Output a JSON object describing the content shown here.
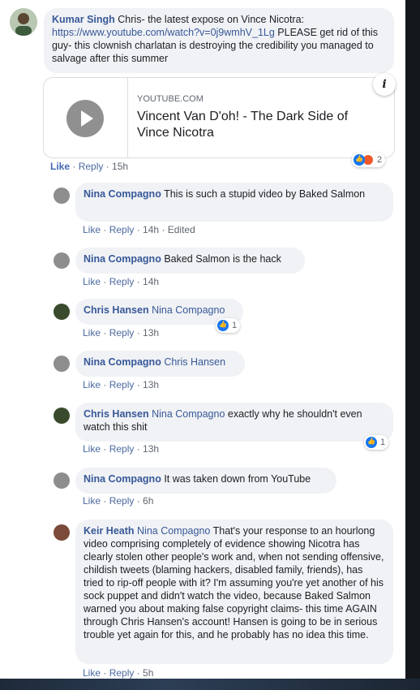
{
  "post": {
    "author": "Kumar Singh",
    "text_before_link": " Chris- the latest expose on Vince Nicotra: ",
    "link": "https://www.youtube.com/watch?v=0j9wmhV_1Lg",
    "text_after_link": " PLEASE get rid of this guy- this clownish charlatan is destroying the credibility you managed to salvage after this summer",
    "card": {
      "domain": "YOUTUBE.COM",
      "title": "Vincent Van D'oh! - The Dark Side of Vince Nicotra"
    },
    "info_glyph": "i",
    "reaction_count": "2",
    "actions": {
      "like": "Like",
      "reply": "Reply",
      "time": "15h"
    }
  },
  "replies": [
    {
      "author": "Nina Compagno",
      "tag": "",
      "text": " This is such a stupid video by Baked Salmon",
      "meta_like": "Like",
      "meta_reply": "Reply",
      "time": "14h",
      "edited": "Edited"
    },
    {
      "author": "Nina Compagno",
      "tag": "",
      "text": " Baked Salmon is the hack",
      "meta_like": "Like",
      "meta_reply": "Reply",
      "time": "14h"
    },
    {
      "author": "Chris Hansen",
      "tag": "Nina Compagno",
      "text": "",
      "meta_like": "Like",
      "meta_reply": "Reply",
      "time": "13h",
      "reactions": "1"
    },
    {
      "author": "Nina Compagno",
      "tag": "Chris Hansen",
      "text": "",
      "meta_like": "Like",
      "meta_reply": "Reply",
      "time": "13h"
    },
    {
      "author": "Chris Hansen",
      "tag": "Nina Compagno",
      "text": " exactly why he shouldn't even watch this shit",
      "meta_like": "Like",
      "meta_reply": "Reply",
      "time": "13h",
      "reactions": "1"
    },
    {
      "author": "Nina Compagno",
      "tag": "",
      "text": " It was taken down from YouTube",
      "meta_like": "Like",
      "meta_reply": "Reply",
      "time": "6h"
    },
    {
      "author": "Keir Heath",
      "tag": "Nina Compagno",
      "text": " That's your response to an hourlong video comprising completely of evidence showing Nicotra has clearly stolen other people's work and, when not sending offensive, childish tweets (blaming hackers, disabled family, friends), has tried to rip-off people with it? I'm assuming you're yet another of his sock puppet and didn't watch the video, because Baked Salmon warned you about making false copyright claims- this time AGAIN through Chris Hansen's account! Hansen is going to be in serious trouble yet again for this, and he probably has no idea this time.",
      "meta_like": "Like",
      "meta_reply": "Reply",
      "time": "5h"
    }
  ],
  "colors": {
    "link": "#385898",
    "bubble": "#f0f2f5",
    "like_blue": "#1877f2",
    "angry": "#f0582a"
  },
  "icons": {
    "play": "play-icon",
    "info": "info-icon",
    "like": "like-reaction-icon",
    "angry": "angry-reaction-icon"
  }
}
